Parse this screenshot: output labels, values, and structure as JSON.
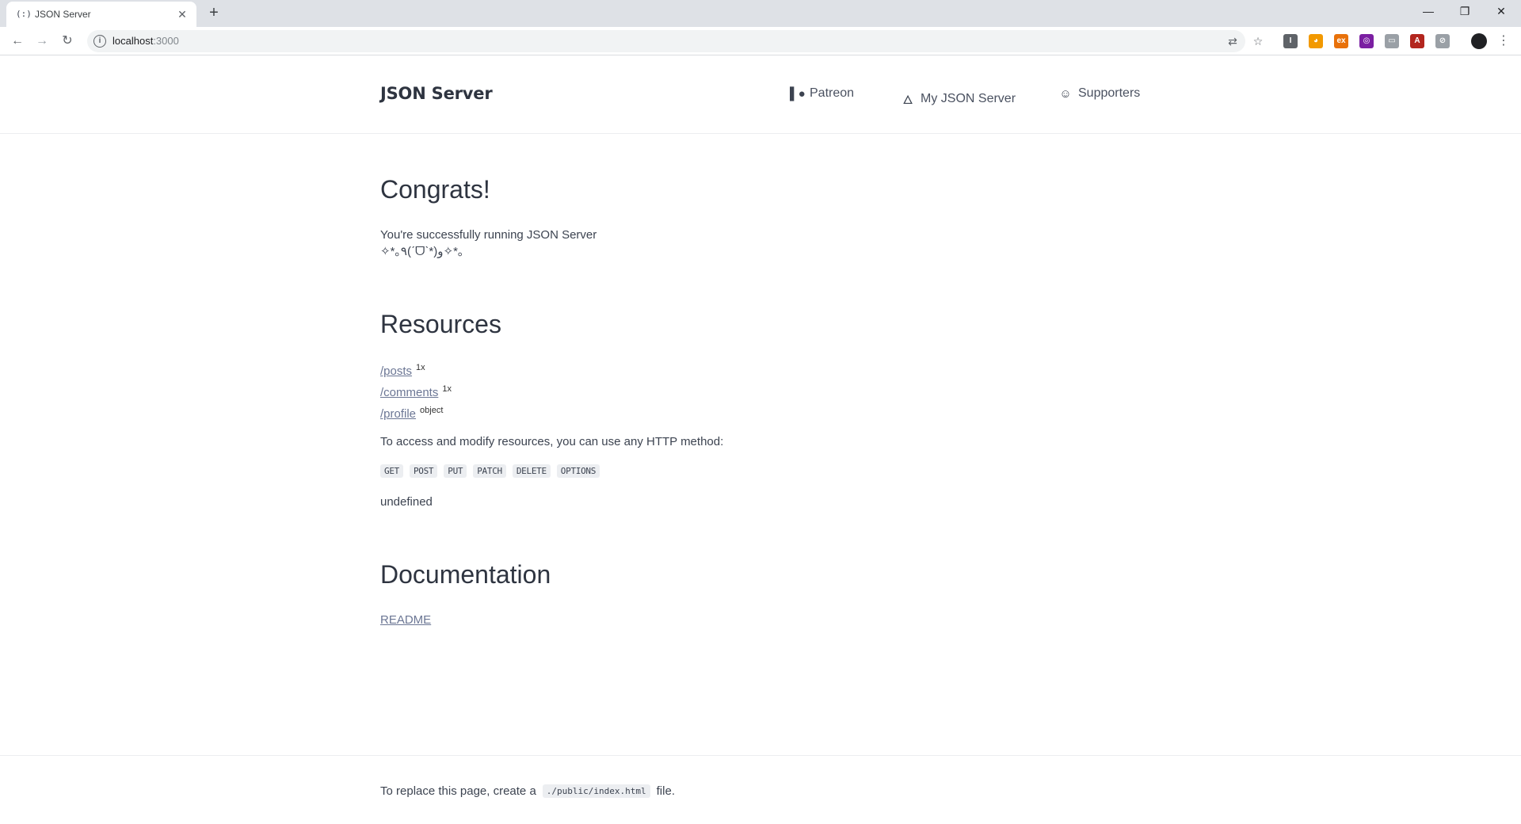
{
  "browser": {
    "tab_title": "JSON Server",
    "tab_favicon": "(:)",
    "url_host": "localhost",
    "url_port": ":3000",
    "extensions": [
      {
        "name": "ext-icon-1",
        "color": "#5f6368",
        "glyph": "I"
      },
      {
        "name": "ext-icon-2",
        "color": "#f29900",
        "glyph": "◕"
      },
      {
        "name": "ext-icon-3",
        "color": "#e8710a",
        "glyph": "ex"
      },
      {
        "name": "ext-icon-4",
        "color": "#7b1fa2",
        "glyph": "◎"
      },
      {
        "name": "ext-icon-5",
        "color": "#9aa0a6",
        "glyph": "▭"
      },
      {
        "name": "ext-icon-6",
        "color": "#b3261e",
        "glyph": "A"
      },
      {
        "name": "ext-icon-7",
        "color": "#9aa0a6",
        "glyph": "⊘"
      }
    ]
  },
  "header": {
    "brand": "JSON Server",
    "nav": [
      {
        "label": "Patreon",
        "icon": "patreon-icon"
      },
      {
        "label": "My JSON Server",
        "icon": "flame-icon"
      },
      {
        "label": "Supporters",
        "icon": "smile-icon"
      }
    ]
  },
  "congrats": {
    "heading": "Congrats!",
    "line1": "You're successfully running JSON Server",
    "line2": "✧*｡٩(ˊᗜˋ*)و✧*｡"
  },
  "resources": {
    "heading": "Resources",
    "items": [
      {
        "path": "/posts",
        "badge": "1x"
      },
      {
        "path": "/comments",
        "badge": "1x"
      },
      {
        "path": "/profile",
        "badge": "object"
      }
    ],
    "access_text": "To access and modify resources, you can use any HTTP method:",
    "methods": [
      "GET",
      "POST",
      "PUT",
      "PATCH",
      "DELETE",
      "OPTIONS"
    ],
    "undefined_text": "undefined"
  },
  "documentation": {
    "heading": "Documentation",
    "link": "README"
  },
  "footer": {
    "before": "To replace this page, create a",
    "code": "./public/index.html",
    "after": "file."
  }
}
